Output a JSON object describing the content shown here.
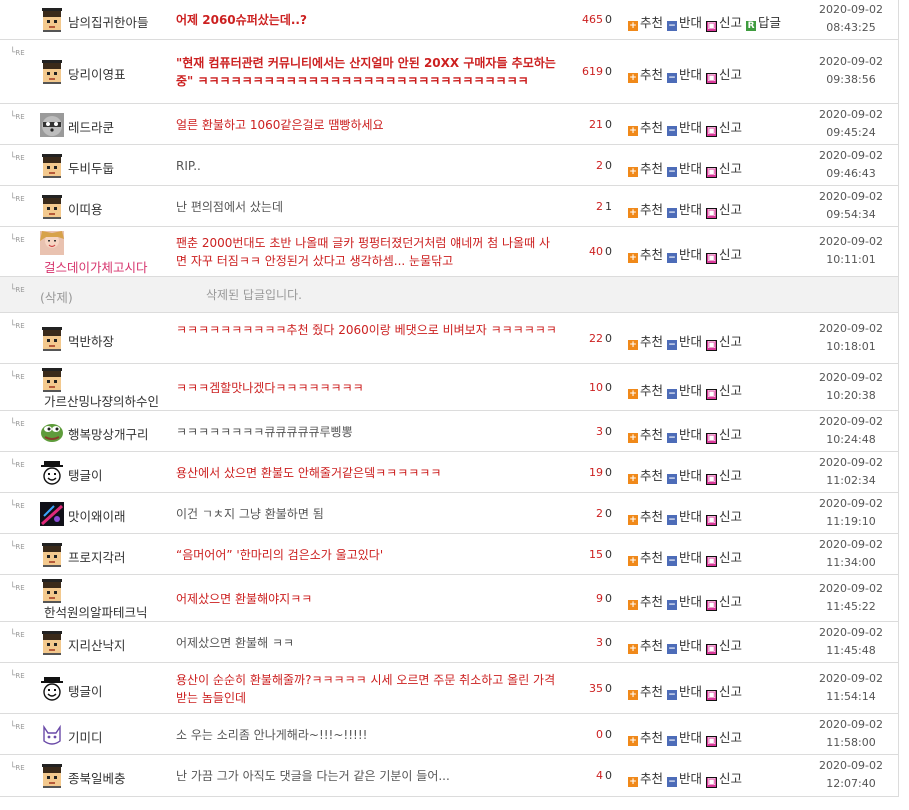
{
  "labels": {
    "recommend": "추천",
    "oppose": "반대",
    "report": "신고",
    "reply": "답글",
    "re_marker": "RE"
  },
  "comments": [
    {
      "nick": "남의집귀한아들",
      "avatar": "pixel-man",
      "content": "어제 2060슈퍼샀는데..?",
      "style": "red bold",
      "likes": "465",
      "dislikes": "0",
      "date": "2020-09-02",
      "time": "08:43:25",
      "is_reply": false,
      "has_reply_btn": true
    },
    {
      "nick": "당리이영표",
      "avatar": "pixel-man",
      "content": "\"현재 컴퓨터관련 커뮤니티에서는 산지얼마 안된 20XX 구매자들 추모하는중\" ㅋㅋㅋㅋㅋㅋㅋㅋㅋㅋㅋㅋㅋㅋㅋㅋㅋㅋㅋㅋㅋㅋㅋㅋㅋㅋㅋㅋㅋㅋ",
      "style": "red bold",
      "likes": "619",
      "dislikes": "0",
      "date": "2020-09-02",
      "time": "09:38:56",
      "is_reply": true
    },
    {
      "nick": "레드라쿤",
      "avatar": "raccoon",
      "content": "얼른 환불하고 1060같은걸로 땜빵하세요",
      "style": "red",
      "likes": "21",
      "dislikes": "0",
      "date": "2020-09-02",
      "time": "09:45:24",
      "is_reply": true
    },
    {
      "nick": "두비두둡",
      "avatar": "pixel-man",
      "content": "RIP..",
      "style": "",
      "likes": "2",
      "dislikes": "0",
      "date": "2020-09-02",
      "time": "09:46:43",
      "is_reply": true
    },
    {
      "nick": "이띠용",
      "avatar": "pixel-man",
      "content": "난 편의점에서 샀는데",
      "style": "",
      "likes": "2",
      "dislikes": "1",
      "date": "2020-09-02",
      "time": "09:54:34",
      "is_reply": true
    },
    {
      "nick": "걸스데이가체고시다",
      "avatar": "girl-photo",
      "content": "팬춘 2000번대도 초반 나올때 글카 펑펑터졌던거처럼 얘네꺼 첨 나올때 사면 자꾸 터짐ㅋㅋ 안정된거 샀다고 생각하셈... 눈물닦고",
      "style": "red",
      "likes": "40",
      "dislikes": "0",
      "date": "2020-09-02",
      "time": "10:11:01",
      "is_reply": true
    },
    {
      "nick": "(삭제)",
      "avatar": "",
      "content": "삭제된 답글입니다.",
      "style": "gray",
      "deleted": true,
      "is_reply": true
    },
    {
      "nick": "먹반하장",
      "avatar": "pixel-man",
      "content": "ㅋㅋㅋㅋㅋㅋㅋㅋㅋㅋ추천 줬다 2060이랑 베댓으로 비벼보자 ㅋㅋㅋㅋㅋㅋ",
      "style": "red",
      "likes": "22",
      "dislikes": "0",
      "date": "2020-09-02",
      "time": "10:18:01",
      "is_reply": true
    },
    {
      "nick": "가르산밍나쟝의하수인",
      "avatar": "pixel-man",
      "content": "ㅋㅋㅋ겜할맛나겠다ㅋㅋㅋㅋㅋㅋㅋㅋ",
      "style": "red",
      "likes": "10",
      "dislikes": "0",
      "date": "2020-09-02",
      "time": "10:20:38",
      "is_reply": true,
      "nick_under": true
    },
    {
      "nick": "행복망상개구리",
      "avatar": "pepe",
      "content": "ㅋㅋㅋㅋㅋㅋㅋㅋ큐큐큐큐큐루삥뽕",
      "style": "",
      "likes": "3",
      "dislikes": "0",
      "date": "2020-09-02",
      "time": "10:24:48",
      "is_reply": true
    },
    {
      "nick": "탱글이",
      "avatar": "smiley",
      "content": "용산에서 샀으면 환불도 안해줄거같은뎈ㅋㅋㅋㅋㅋㅋ",
      "style": "red",
      "likes": "19",
      "dislikes": "0",
      "date": "2020-09-02",
      "time": "11:02:34",
      "is_reply": true
    },
    {
      "nick": "맛이왜이래",
      "avatar": "neon",
      "content": "이건 ㄱㅊ지 그냥 환불하면 됨",
      "style": "",
      "likes": "2",
      "dislikes": "0",
      "date": "2020-09-02",
      "time": "11:19:10",
      "is_reply": true
    },
    {
      "nick": "프로지각러",
      "avatar": "pixel-man",
      "content": "“음머어어” '한마리의 검은소가 울고있다'",
      "style": "red",
      "likes": "15",
      "dislikes": "0",
      "date": "2020-09-02",
      "time": "11:34:00",
      "is_reply": true
    },
    {
      "nick": "한석원의알파테크닉",
      "avatar": "pixel-man",
      "content": "어제샀으면 환불해야지ㅋㅋ",
      "style": "red",
      "likes": "9",
      "dislikes": "0",
      "date": "2020-09-02",
      "time": "11:45:22",
      "is_reply": true,
      "nick_under": true
    },
    {
      "nick": "지리산낙지",
      "avatar": "pixel-man",
      "content": "어제샀으면 환불해 ㅋㅋ",
      "style": "",
      "likes": "3",
      "dislikes": "0",
      "date": "2020-09-02",
      "time": "11:45:48",
      "is_reply": true
    },
    {
      "nick": "탱글이",
      "avatar": "smiley",
      "content": "용산이 순순히 환불해줄까?ㅋㅋㅋㅋㅋ 시세 오르면 주문 취소하고 올린 가격 받는 놈들인데",
      "style": "red",
      "likes": "35",
      "dislikes": "0",
      "date": "2020-09-02",
      "time": "11:54:14",
      "is_reply": true
    },
    {
      "nick": "기미디",
      "avatar": "cat",
      "content": "소 우는 소리좀 안나게해라~!!!~!!!!!",
      "style": "",
      "likes": "0",
      "dislikes": "0",
      "date": "2020-09-02",
      "time": "11:58:00",
      "is_reply": true
    },
    {
      "nick": "종북일베충",
      "avatar": "pixel-man",
      "content": "난 가끔 그가 아직도 댓글을 다는거 같은 기분이 들어...",
      "style": "",
      "likes": "4",
      "dislikes": "0",
      "date": "2020-09-02",
      "time": "12:07:40",
      "is_reply": true
    }
  ]
}
